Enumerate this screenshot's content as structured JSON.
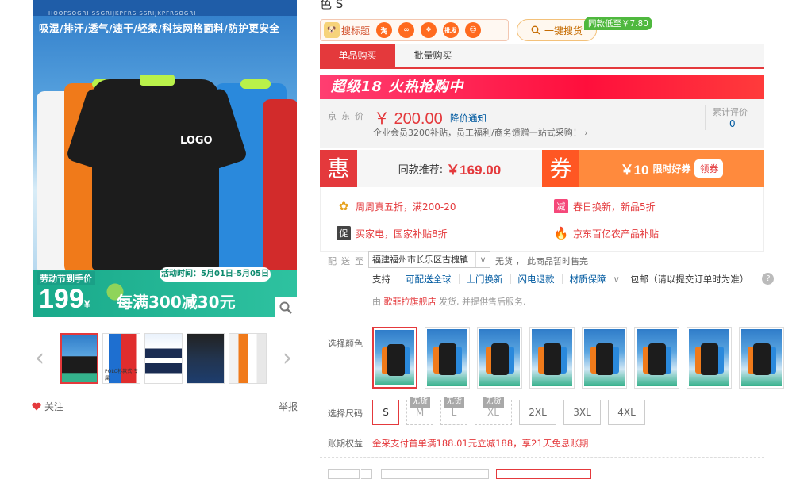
{
  "gallery": {
    "banner_tiny": "HOOFSOGRI SSGRIJKPFRS SSRIJKPFRSOGRI",
    "banner_text": "吸湿/排汗/透气/速干/轻柔/科技网格面料/防护更安全",
    "logo_text": "LOGO",
    "promo_tag": "劳动节到手价",
    "promo_date": "活动时间：5月01日-5月05日",
    "promo_price": "199",
    "promo_unit": "¥",
    "promo_sale": "每满300减30元",
    "thumb_caption": "POLO衫款式·专属",
    "follow_label": "关注",
    "report_label": "举报"
  },
  "header": {
    "title_fragment": "色 S",
    "toolbar_label": "搜标题",
    "toolbar_icons": [
      "淘",
      "批发"
    ],
    "one_key_label": "一键搜货",
    "low_tag": "同款低至￥7.80"
  },
  "tabs": [
    "单品购买",
    "批量购买"
  ],
  "sale_banner": "超级18 火热抢购中",
  "price": {
    "label": "京东价",
    "value": "￥ 200.00",
    "notify": "降价通知",
    "sub": "企业会员3200补贴，员工福利/商务馈赠一站式采购！ ›",
    "review_label": "累计评价",
    "review_count": "0"
  },
  "deal": {
    "hui_char": "惠",
    "same_label": "同款推荐:",
    "same_price": "￥169.00",
    "quan_char": "券",
    "coupon_value": "￥10",
    "coupon_label": "限时好券",
    "coupon_btn": "领券"
  },
  "promos": [
    {
      "icon": "flower-icon",
      "text": "周周真五折，满200-20",
      "color": "#e4393c"
    },
    {
      "icon_char": "减",
      "text": "春日换新，新品5折",
      "color": "#e4393c"
    },
    {
      "icon_char": "促",
      "text": "买家电，国家补贴8折",
      "color": "#e4393c"
    },
    {
      "icon": "fire-icon",
      "text": "京东百亿农产品补贴",
      "color": "#e4393c"
    }
  ],
  "delivery": {
    "label": "配送至",
    "location": "福建福州市长乐区古槐镇",
    "status": "无货 ， 此商品暂时售完",
    "services": [
      "支持",
      "可配送全球",
      "上门换新",
      "闪电退款",
      "材质保障",
      "包邮（请以提交订单时为准）"
    ],
    "help": "?",
    "seller_prefix": "由",
    "seller_name": "歌菲拉旗舰店",
    "seller_suffix": "发货, 并提供售后服务."
  },
  "color": {
    "label": "选择颜色",
    "option_count_text": "8"
  },
  "size": {
    "label": "选择尺码",
    "options": [
      {
        "label": "S",
        "state": "selected",
        "badge": ""
      },
      {
        "label": "M",
        "state": "disabled",
        "badge": "无货"
      },
      {
        "label": "L",
        "state": "disabled",
        "badge": "无货"
      },
      {
        "label": "XL",
        "state": "disabled",
        "badge": "无货"
      },
      {
        "label": "2XL",
        "state": "normal",
        "badge": ""
      },
      {
        "label": "3XL",
        "state": "normal",
        "badge": ""
      },
      {
        "label": "4XL",
        "state": "normal",
        "badge": ""
      }
    ]
  },
  "payment": {
    "label": "账期权益",
    "text": "金采支付首单满188.01元立减188，享21天免息账期"
  },
  "colors": {
    "accent": "#e4393c",
    "link": "#005aa0",
    "coupon_orange": "#ff8a3d"
  }
}
